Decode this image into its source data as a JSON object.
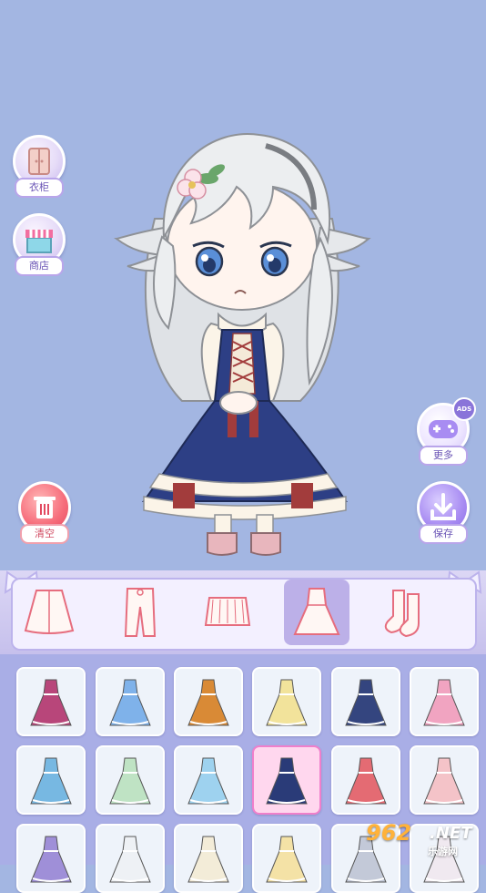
{
  "buttons": {
    "wardrobe": "衣柜",
    "shop": "商店",
    "more": "更多",
    "more_badge": "ADS",
    "clear": "清空",
    "save": "保存"
  },
  "categories": [
    {
      "name": "coat"
    },
    {
      "name": "pants"
    },
    {
      "name": "skirt"
    },
    {
      "name": "dress",
      "active": true
    },
    {
      "name": "socks"
    }
  ],
  "outfit_items": [
    {
      "id": 1,
      "color": "#b8467a"
    },
    {
      "id": 2,
      "color": "#7fb2ea"
    },
    {
      "id": 3,
      "color": "#d98a36"
    },
    {
      "id": 4,
      "color": "#f2e39b"
    },
    {
      "id": 5,
      "color": "#34457f"
    },
    {
      "id": 6,
      "color": "#f1a4c1"
    },
    {
      "id": 7,
      "color": "#77b8e2"
    },
    {
      "id": 8,
      "color": "#bfe3c4"
    },
    {
      "id": 9,
      "color": "#9ed2ef"
    },
    {
      "id": 10,
      "color": "#2a3b78",
      "selected": true
    },
    {
      "id": 11,
      "color": "#e46b73"
    },
    {
      "id": 12,
      "color": "#f4c3c8"
    },
    {
      "id": 13,
      "color": "#9f8fd8"
    },
    {
      "id": 14,
      "color": "#eef1f5"
    },
    {
      "id": 15,
      "color": "#f3ecd8"
    },
    {
      "id": 16,
      "color": "#f4e2a6"
    },
    {
      "id": 17,
      "color": "#c3c9d8"
    },
    {
      "id": 18,
      "color": "#f0e9f0"
    }
  ],
  "watermark": {
    "number": "962",
    "suffix": ".NET",
    "subtitle": "乐游网"
  },
  "colors": {
    "background": "#a3b6e2",
    "dress_navy": "#2d3f85",
    "accent_purple": "#8a74d9",
    "clear_red": "#e24a60"
  }
}
